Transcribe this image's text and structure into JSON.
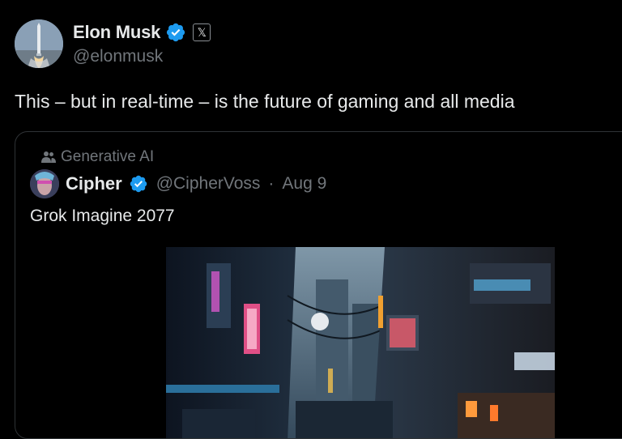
{
  "author": {
    "name": "Elon Musk",
    "handle": "@elonmusk",
    "verified_color": "#1d9bf0",
    "affiliation_badge": "𝕏"
  },
  "tweet": {
    "text": "This – but in real-time – is the future of gaming and all media"
  },
  "quote": {
    "context_label": "Generative AI",
    "context_icon": "community-icon",
    "author_name": "Cipher",
    "author_handle": "@CipherVoss",
    "separator": "·",
    "date": "Aug 9",
    "text": "Grok Imagine 2077",
    "media_description": "cyberpunk-alley-image"
  },
  "colors": {
    "background": "#000000",
    "primary_text": "#e7e9ea",
    "secondary_text": "#71767b",
    "border": "#2f3336"
  }
}
